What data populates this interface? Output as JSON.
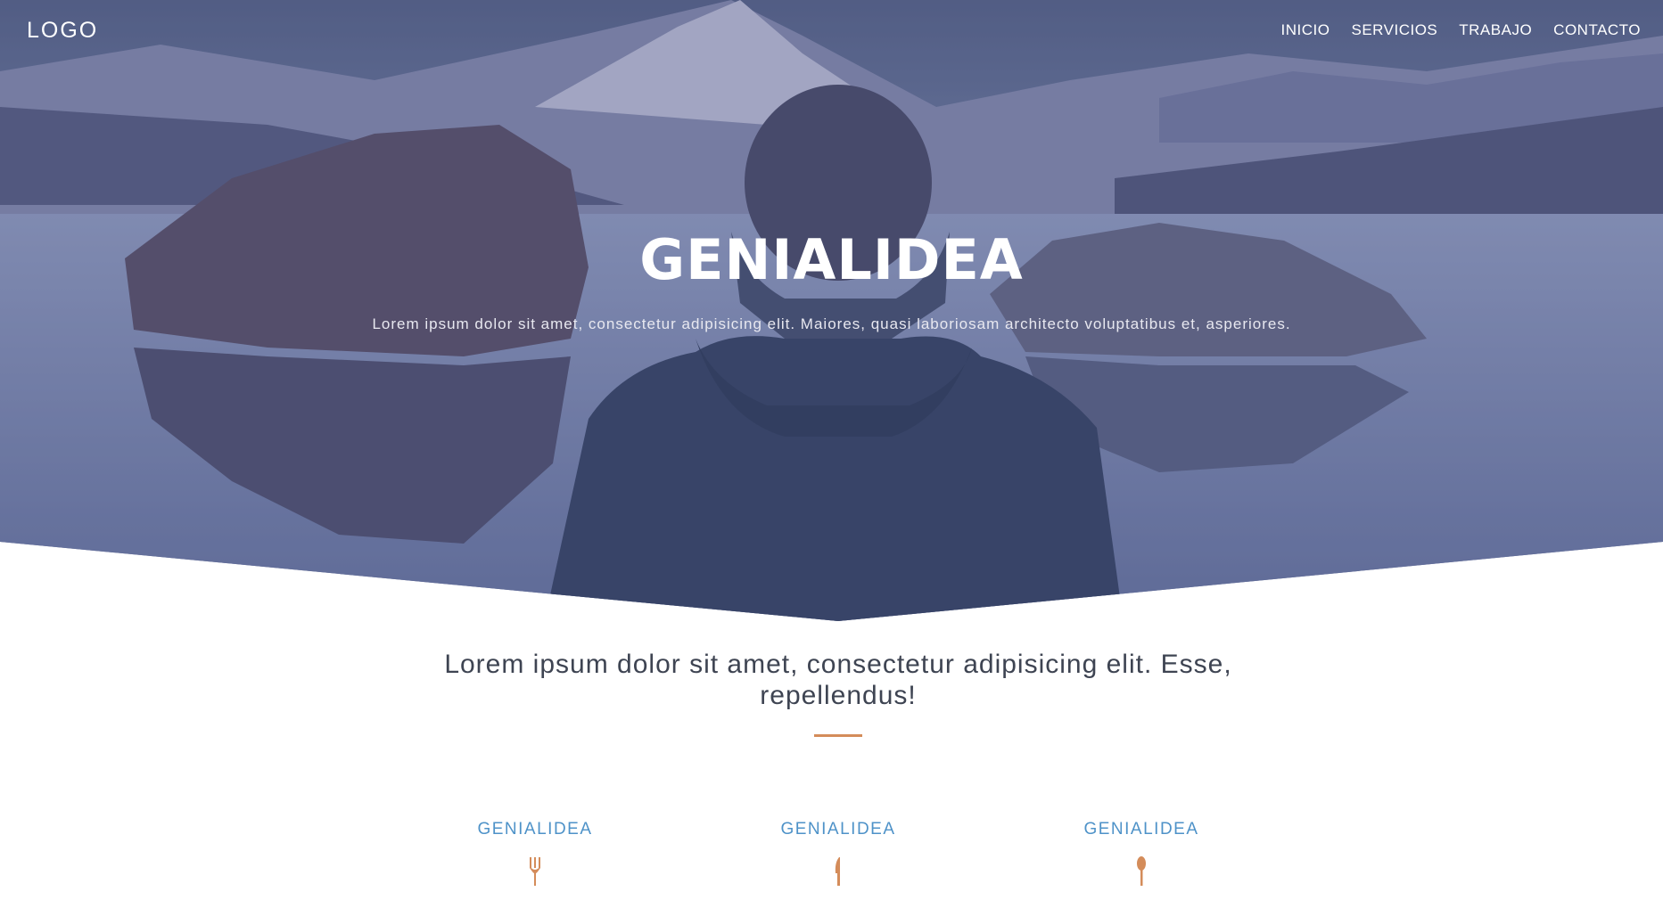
{
  "nav": {
    "logo": "LOGO",
    "items": [
      {
        "label": "INICIO"
      },
      {
        "label": "SERVICIOS"
      },
      {
        "label": "TRABAJO"
      },
      {
        "label": "CONTACTO"
      }
    ]
  },
  "hero": {
    "title": "GENIALIDEA",
    "subtitle": "Lorem ipsum dolor sit amet, consectetur adipisicing elit. Maiores, quasi laboriosam architecto voluptatibus et, asperiores."
  },
  "intro": {
    "text": "Lorem ipsum dolor sit amet, consectetur adipisicing elit. Esse, repellendus!"
  },
  "features": [
    {
      "title": "GENIALIDEA",
      "icon": "fork-icon"
    },
    {
      "title": "GENIALIDEA",
      "icon": "knife-icon"
    },
    {
      "title": "GENIALIDEA",
      "icon": "spoon-icon"
    }
  ],
  "colors": {
    "accent": "#d48c5a",
    "feature_title": "#4e92c8",
    "intro_text": "#3e4452",
    "hero_overlay": "#3c4a7a"
  }
}
